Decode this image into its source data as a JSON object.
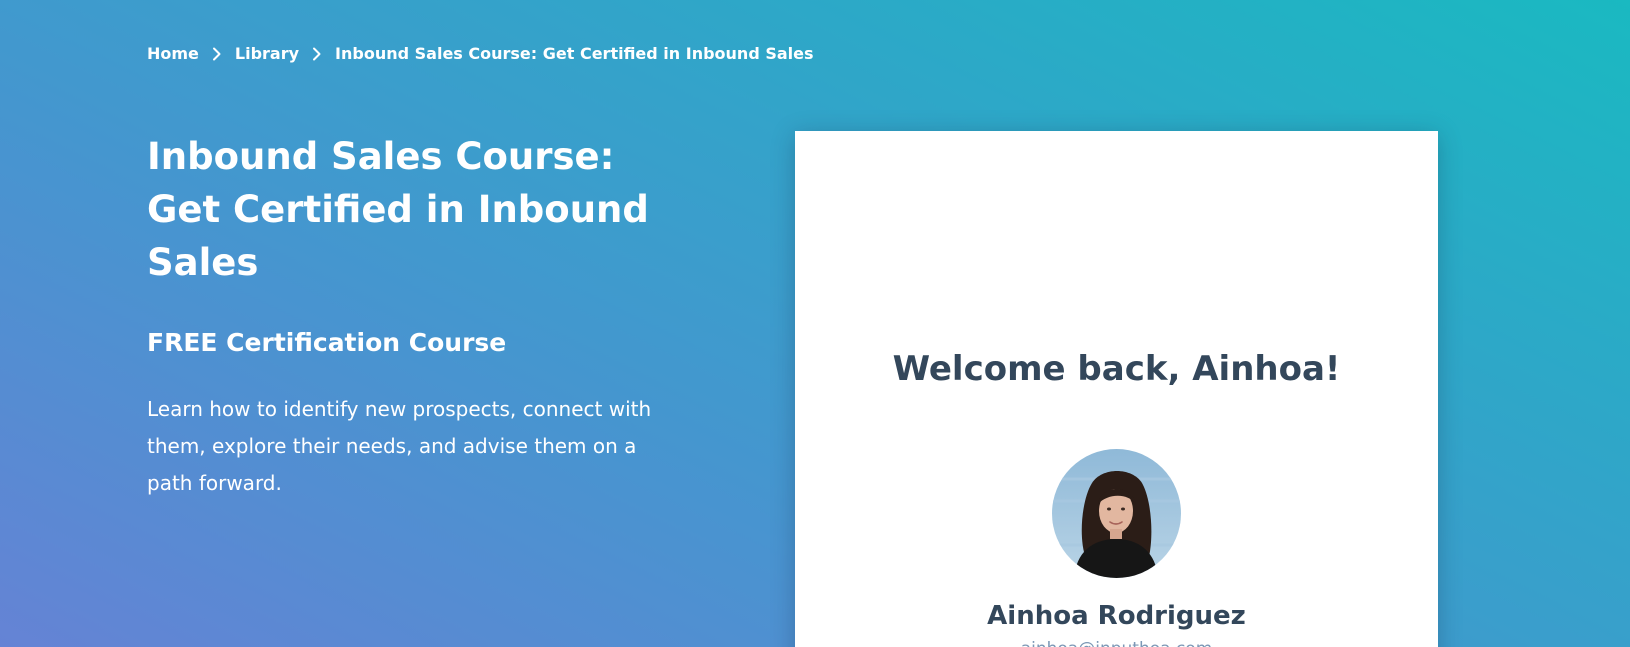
{
  "breadcrumb": {
    "items": [
      {
        "label": "Home"
      },
      {
        "label": "Library"
      },
      {
        "label": "Inbound Sales Course: Get Certified in Inbound Sales"
      }
    ],
    "separator_icon": "chevron-right-icon"
  },
  "hero": {
    "title": "Inbound Sales Course: Get Certified in Inbound Sales",
    "subtitle": "FREE Certification Course",
    "description": "Learn how to identify new prospects, connect with them, explore their needs, and advise them on a path forward."
  },
  "card": {
    "welcome": "Welcome back, Ainhoa!",
    "user_name": "Ainhoa Rodriguez",
    "user_email": "ainhoa@inputhoa.com"
  },
  "colors": {
    "gradient_start": "#6583d5",
    "gradient_end": "#1ab9c1",
    "card_heading": "#33475b",
    "card_subtext": "#7c98b6"
  }
}
